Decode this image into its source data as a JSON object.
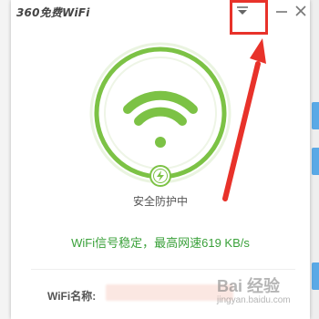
{
  "app": {
    "logo_prefix": "360免费",
    "logo_wifi": "WiFi"
  },
  "status": {
    "label": "安全防护中"
  },
  "speed": {
    "text": "WiFi信号稳定，最高网速619 KB/s"
  },
  "info": {
    "name_label": "WiFi名称:"
  },
  "watermark": {
    "brand": "Bai 经验",
    "url": "jingyan.baidu.com"
  },
  "colors": {
    "accent_green": "#7cc245",
    "text_green": "#3aa13a",
    "annotation_red": "#e8322a"
  },
  "icons": {
    "menu": "dropdown-triangle-icon",
    "minimize": "minimize-icon",
    "close": "close-icon",
    "wifi": "wifi-signal-icon",
    "shield": "lightning-shield-icon"
  }
}
